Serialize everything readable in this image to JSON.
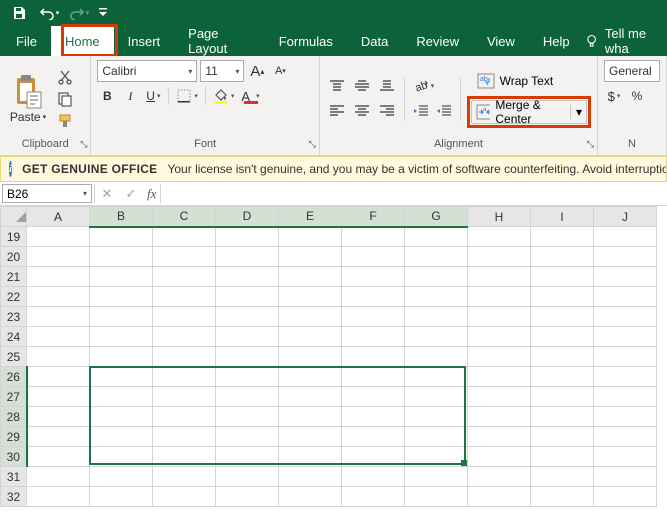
{
  "qat": {
    "save": "save-icon",
    "undo": "undo-icon",
    "redo": "redo-icon"
  },
  "menu": {
    "tabs": [
      "File",
      "Home",
      "Insert",
      "Page Layout",
      "Formulas",
      "Data",
      "Review",
      "View",
      "Help"
    ],
    "active": "Home",
    "tellme": "Tell me wha"
  },
  "ribbon": {
    "clipboard": {
      "label": "Clipboard",
      "paste": "Paste"
    },
    "font": {
      "label": "Font",
      "name": "Calibri",
      "size": "11",
      "increaseA": "A",
      "decreaseA": "A",
      "bold": "B",
      "italic": "I",
      "underline": "U"
    },
    "alignment": {
      "label": "Alignment",
      "wrap": "Wrap Text",
      "merge": "Merge & Center"
    },
    "number": {
      "label": "N",
      "format": "General",
      "acct": "$"
    }
  },
  "warning": {
    "title": "GET GENUINE OFFICE",
    "text": "Your license isn't genuine, and you may be a victim of software counterfeiting. Avoid interruptio"
  },
  "formula": {
    "namebox": "B26",
    "fx": "fx",
    "value": ""
  },
  "grid": {
    "cols": [
      "A",
      "B",
      "C",
      "D",
      "E",
      "F",
      "G",
      "H",
      "I",
      "J"
    ],
    "rows": [
      "19",
      "20",
      "21",
      "22",
      "23",
      "24",
      "25",
      "26",
      "27",
      "28",
      "29",
      "30",
      "31",
      "32"
    ],
    "sel_cols": [
      "B",
      "C",
      "D",
      "E",
      "F",
      "G"
    ],
    "sel_rows": [
      "26",
      "27",
      "28",
      "29",
      "30"
    ],
    "active_cell": "B26"
  }
}
